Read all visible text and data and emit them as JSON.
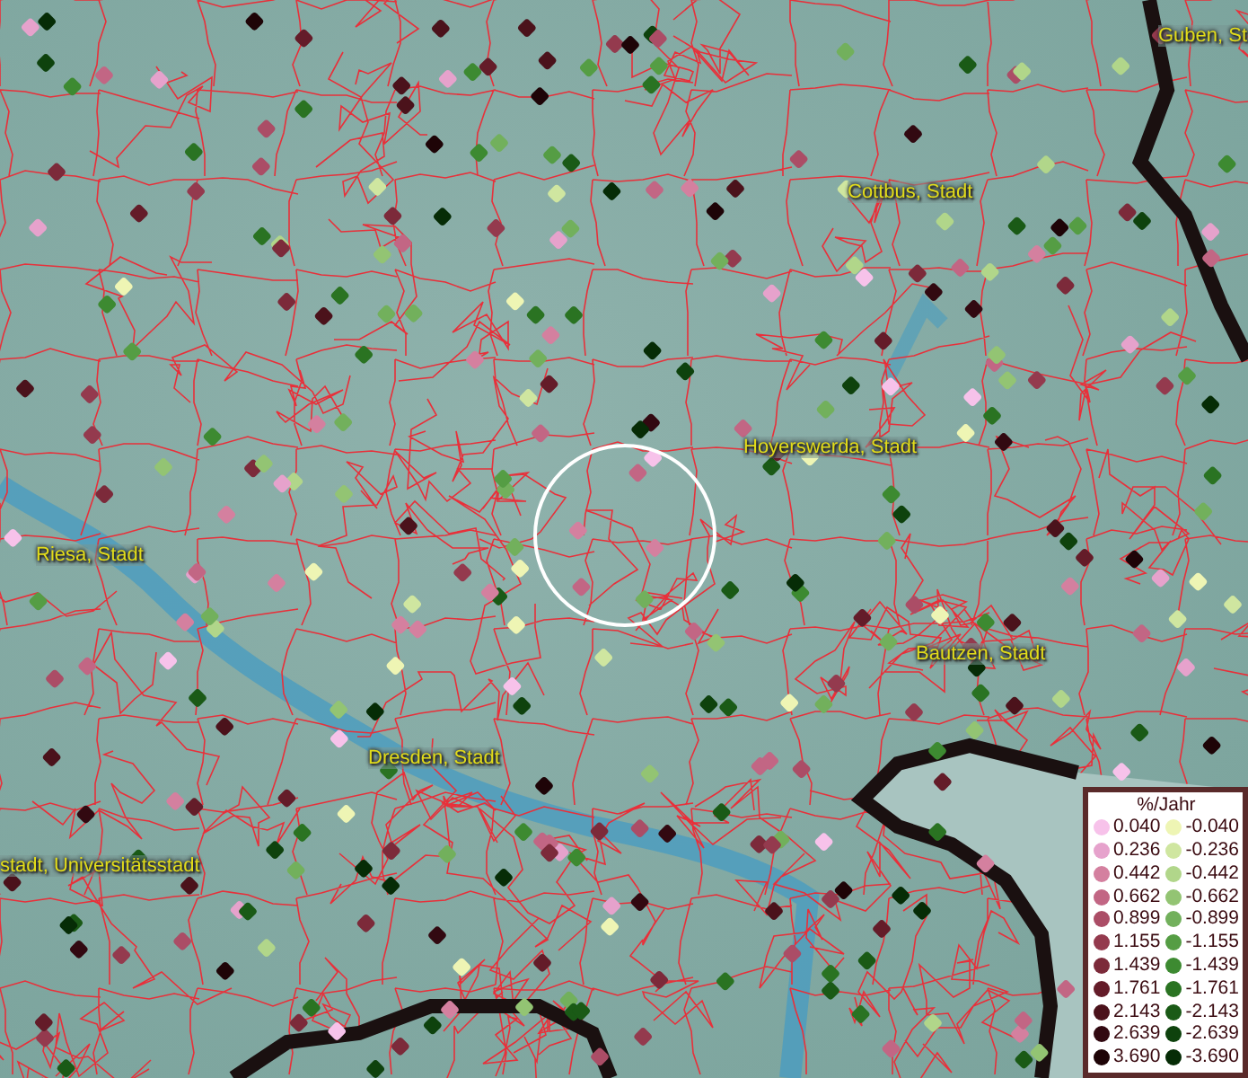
{
  "map": {
    "places": [
      {
        "name": "Guben, St"
      },
      {
        "name": "Cottbus, Stadt"
      },
      {
        "name": "Hoyerswerda, Stadt"
      },
      {
        "name": "Riesa, Stadt"
      },
      {
        "name": "Bautzen, Stadt"
      },
      {
        "name": "Dresden, Stadt"
      },
      {
        "name": "stadt, Universitätsstadt"
      }
    ]
  },
  "legend": {
    "title": "%/Jahr",
    "items": [
      {
        "value": "0.040",
        "color": "#f7c2ea"
      },
      {
        "value": "-0.040",
        "color": "#eef5b4"
      },
      {
        "value": "0.236",
        "color": "#e6a2cc"
      },
      {
        "value": "-0.236",
        "color": "#cfe6a0"
      },
      {
        "value": "0.442",
        "color": "#d4809f"
      },
      {
        "value": "-0.442",
        "color": "#b1d68a"
      },
      {
        "value": "0.662",
        "color": "#c26684"
      },
      {
        "value": "-0.662",
        "color": "#93c473"
      },
      {
        "value": "0.899",
        "color": "#ab4d66"
      },
      {
        "value": "-0.899",
        "color": "#72b05c"
      },
      {
        "value": "1.155",
        "color": "#943a4e"
      },
      {
        "value": "-1.155",
        "color": "#559d44"
      },
      {
        "value": "1.439",
        "color": "#7c2a3a"
      },
      {
        "value": "-1.439",
        "color": "#3d8a31"
      },
      {
        "value": "1.761",
        "color": "#641c29"
      },
      {
        "value": "-1.761",
        "color": "#2a7322"
      },
      {
        "value": "2.143",
        "color": "#4b121b"
      },
      {
        "value": "-2.143",
        "color": "#1a5a16"
      },
      {
        "value": "2.639",
        "color": "#320911"
      },
      {
        "value": "-2.639",
        "color": "#0e420d"
      },
      {
        "value": "3.690",
        "color": "#1e0407"
      },
      {
        "value": "-3.690",
        "color": "#062c06"
      }
    ]
  }
}
